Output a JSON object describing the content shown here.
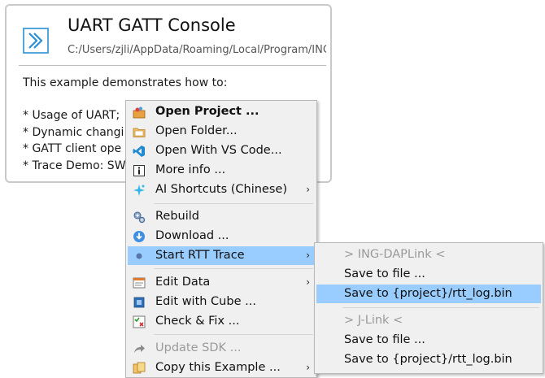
{
  "card": {
    "title": "UART GATT Console",
    "path": "C:/Users/zjli/AppData/Roaming/Local/Program/ING_SDK/examples/uart_console",
    "description": "This example demonstrates how to:",
    "bullets": [
      "* Usage of UART;",
      "* Dynamic changi",
      "* GATT client ope",
      "* Trace Demo: SW"
    ]
  },
  "menu": {
    "items": [
      {
        "label": "Open Project ...",
        "icon": "open-project-icon"
      },
      {
        "label": "Open Folder...",
        "icon": "folder-icon"
      },
      {
        "label": "Open With VS Code...",
        "icon": "vscode-icon"
      },
      {
        "label": "More info ...",
        "icon": "info-icon"
      },
      {
        "label": "AI Shortcuts (Chinese)",
        "icon": "ai-icon",
        "arrow": "›"
      },
      {
        "label": "Rebuild",
        "icon": "gears-icon"
      },
      {
        "label": "Download ...",
        "icon": "download-icon"
      },
      {
        "label": "Start RTT Trace",
        "icon": "dot-icon",
        "arrow": "›"
      },
      {
        "label": "Edit Data",
        "icon": "edit-data-icon",
        "arrow": "›"
      },
      {
        "label": "Edit with Cube ...",
        "icon": "cube-icon"
      },
      {
        "label": "Check & Fix ...",
        "icon": "check-fix-icon"
      },
      {
        "label": "Update SDK ...",
        "icon": "share-icon"
      },
      {
        "label": "Copy this Example ...",
        "icon": "copy-icon",
        "arrow": "›"
      }
    ]
  },
  "submenu": {
    "items": [
      {
        "label": "> ING-DAPLink <"
      },
      {
        "label": "Save to file ..."
      },
      {
        "label": "Save to {project}/rtt_log.bin"
      },
      {
        "label": "> J-Link <"
      },
      {
        "label": "Save to file ..."
      },
      {
        "label": "Save to {project}/rtt_log.bin"
      }
    ]
  },
  "colors": {
    "highlight": "#99ccff",
    "menu_bg": "#f0f0f0",
    "disabled_text": "#9a9a9a",
    "logo": "#2a8fd6"
  }
}
